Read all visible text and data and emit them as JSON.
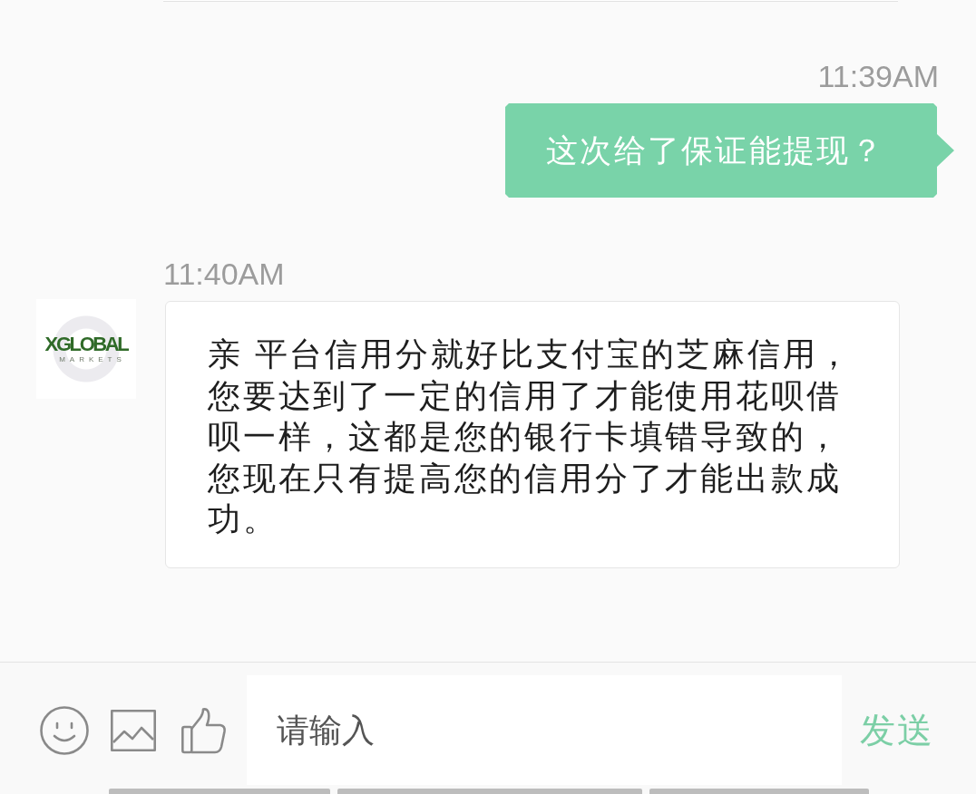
{
  "messages": [
    {
      "kind": "outgoing",
      "time": "11:39AM",
      "text": "这次给了保证能提现？"
    },
    {
      "kind": "incoming",
      "time": "11:40AM",
      "sender_logo": {
        "name": "XGLOBAL",
        "tagline": "MARKETS"
      },
      "text": "亲 平台信用分就好比支付宝的芝麻信用，您要达到了一定的信用了才能使用花呗借呗一样，这都是您的银行卡填错导致的，您现在只有提高您的信用分了才能出款成功。"
    }
  ],
  "composer": {
    "placeholder": "请输入",
    "send_label": "发送"
  }
}
